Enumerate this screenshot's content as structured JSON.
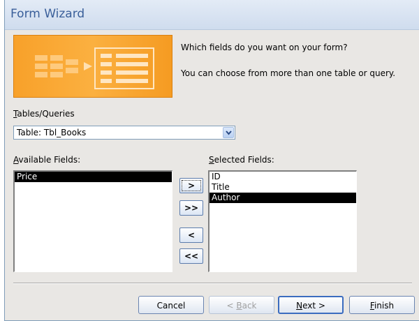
{
  "window": {
    "title": "Form Wizard"
  },
  "intro": {
    "line1": "Which fields do you want on your form?",
    "line2": "You can choose from more than one table or query."
  },
  "tables": {
    "label_accel": "T",
    "label_rest": "ables/Queries",
    "selected": "Table: Tbl_Books"
  },
  "available": {
    "label_accel": "A",
    "label_rest": "vailable Fields:",
    "items": [
      "Price"
    ],
    "selected_index": 0
  },
  "selected_fields": {
    "label_accel": "S",
    "label_rest": "elected Fields:",
    "items": [
      "ID",
      "Title",
      "Author"
    ],
    "selected_index": 2
  },
  "move_buttons": {
    "add_one": ">",
    "add_all": ">>",
    "remove_one": "<",
    "remove_all": "<<"
  },
  "buttons": {
    "cancel": "Cancel",
    "back_pre": "< ",
    "back_accel": "B",
    "back_rest": "ack",
    "next_accel": "N",
    "next_rest": "ext >",
    "finish_accel": "F",
    "finish_rest": "inish"
  },
  "colors": {
    "title_text": "#3a5f9a",
    "selection_bg": "#000000",
    "illustration_orange": "#f8a12a"
  }
}
